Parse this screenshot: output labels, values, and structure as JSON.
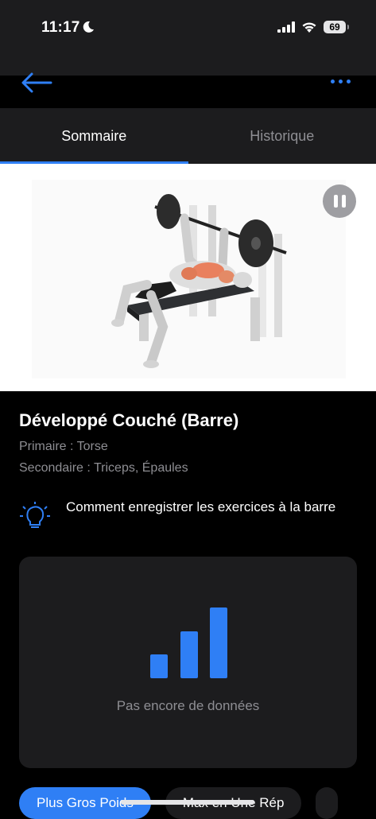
{
  "status_bar": {
    "time": "11:17",
    "battery": "69",
    "moon_icon": "moon-icon",
    "signal_icon": "cellular-signal-icon",
    "wifi_icon": "wifi-icon"
  },
  "nav": {
    "back_icon": "arrow-left-icon",
    "more_icon": "ellipsis-icon"
  },
  "tabs": [
    {
      "label": "Sommaire",
      "active": true
    },
    {
      "label": "Historique",
      "active": false
    }
  ],
  "media": {
    "pause_icon": "pause-icon",
    "illustration": "bench-press-illustration"
  },
  "exercise": {
    "title": "Développé Couché (Barre)",
    "primary": "Primaire : Torse",
    "secondary": "Secondaire : Triceps, Épaules"
  },
  "tip": {
    "icon": "lightbulb-icon",
    "text": "Comment enregistrer les exercices à la barre"
  },
  "chart_card": {
    "icon": "bar-chart-icon",
    "empty_text": "Pas encore de données"
  },
  "chips": [
    {
      "label": "Plus Gros Poids",
      "active": true
    },
    {
      "label": "Max en Une Rép",
      "active": false
    }
  ],
  "colors": {
    "accent": "#2f7ff5",
    "background": "#000000",
    "surface": "#1c1c1e",
    "muted_text": "#8e8e93"
  }
}
